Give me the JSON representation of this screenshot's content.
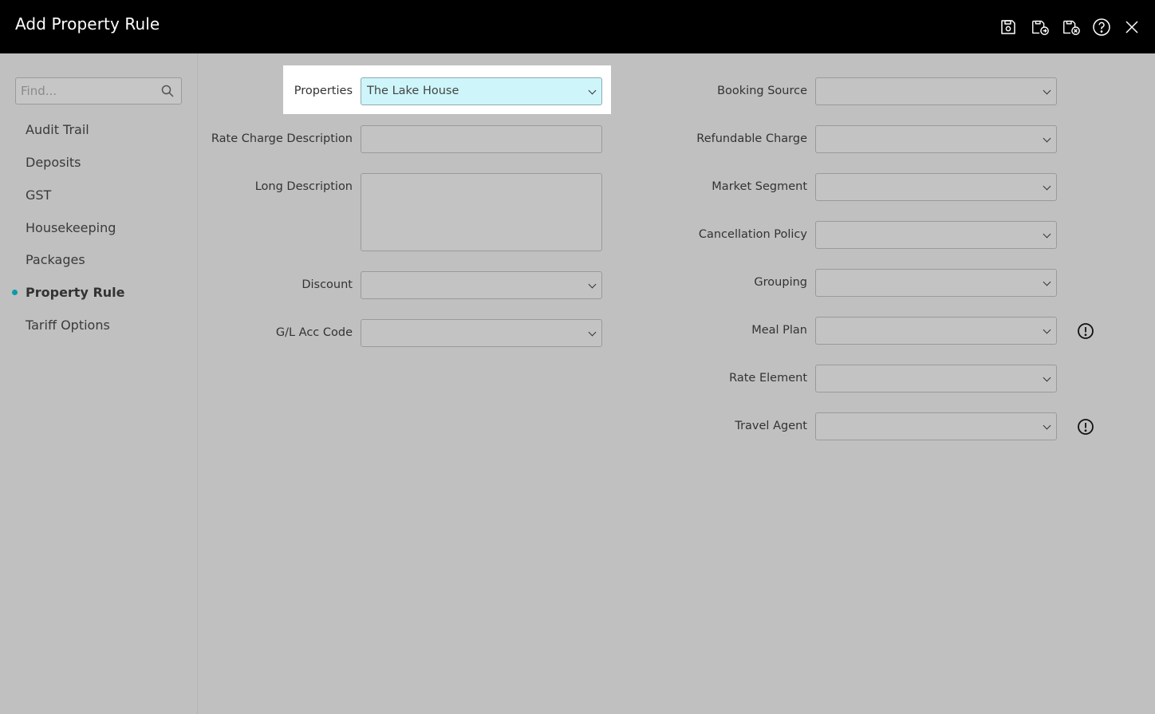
{
  "window": {
    "title": "Add Property Rule"
  },
  "toolbar": {
    "icons": [
      "save-icon",
      "save-and-new-icon",
      "save-and-close-icon",
      "help-icon",
      "close-icon"
    ]
  },
  "sidebar": {
    "search_placeholder": "Find...",
    "items": [
      {
        "label": "Audit Trail",
        "active": false
      },
      {
        "label": "Deposits",
        "active": false
      },
      {
        "label": "GST",
        "active": false
      },
      {
        "label": "Housekeeping",
        "active": false
      },
      {
        "label": "Packages",
        "active": false
      },
      {
        "label": "Property Rule",
        "active": true
      },
      {
        "label": "Tariff Options",
        "active": false
      }
    ]
  },
  "form": {
    "left": {
      "properties": {
        "label": "Properties",
        "value": "The Lake House"
      },
      "rate_charge_description": {
        "label": "Rate Charge Description",
        "value": ""
      },
      "long_description": {
        "label": "Long Description",
        "value": ""
      },
      "discount": {
        "label": "Discount",
        "value": ""
      },
      "gl_acc_code": {
        "label": "G/L Acc Code",
        "value": ""
      }
    },
    "right": {
      "booking_source": {
        "label": "Booking Source",
        "value": ""
      },
      "refundable_charge": {
        "label": "Refundable Charge",
        "value": ""
      },
      "market_segment": {
        "label": "Market Segment",
        "value": ""
      },
      "cancellation_policy": {
        "label": "Cancellation Policy",
        "value": ""
      },
      "grouping": {
        "label": "Grouping",
        "value": ""
      },
      "meal_plan": {
        "label": "Meal Plan",
        "value": ""
      },
      "rate_element": {
        "label": "Rate Element",
        "value": ""
      },
      "travel_agent": {
        "label": "Travel Agent",
        "value": ""
      }
    }
  },
  "colors": {
    "header": "#000000",
    "background": "#c0c0c0",
    "active_dot": "#0b9aa8",
    "highlight_field": "#cef6fa"
  }
}
